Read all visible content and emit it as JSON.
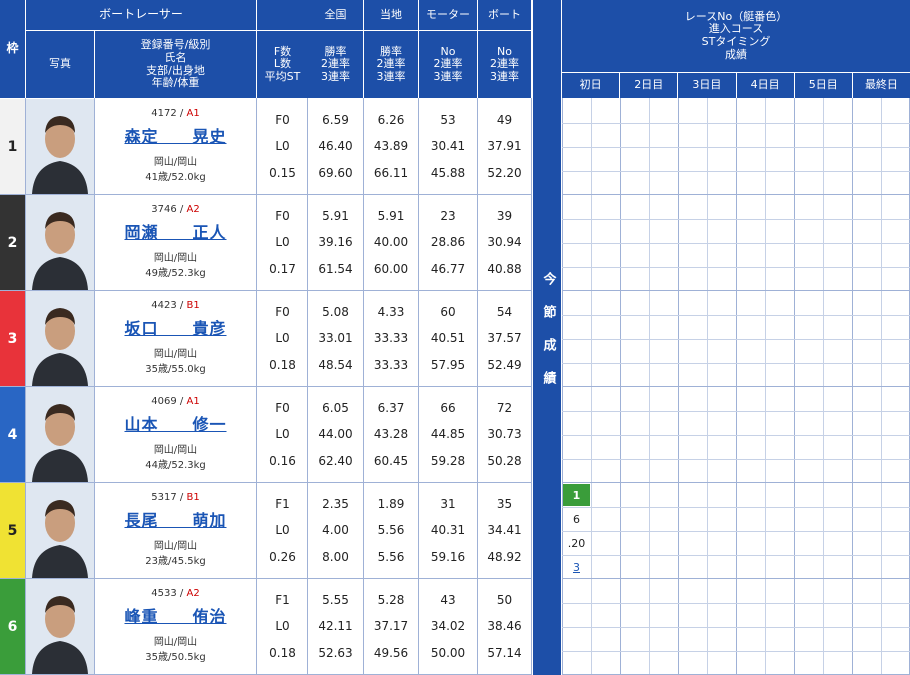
{
  "header": {
    "frame": "枠",
    "boat_racer": "ボートレーサー",
    "national": "全国",
    "local": "当地",
    "motor": "モーター",
    "boat": "ボート",
    "race_info": [
      "レースNo（艇番色）",
      "進入コース",
      "STタイミング",
      "成績"
    ],
    "photo": "写真",
    "racer_info": [
      "登録番号/級別",
      "氏名",
      "支部/出身地",
      "年齢/体重"
    ],
    "fl_st": [
      "F数",
      "L数",
      "平均ST"
    ],
    "rate_nat": [
      "勝率",
      "2連率",
      "3連率"
    ],
    "rate_loc": [
      "勝率",
      "2連率",
      "3連率"
    ],
    "rate_motor": [
      "No",
      "2連率",
      "3連率"
    ],
    "rate_boat": [
      "No",
      "2連率",
      "3連率"
    ],
    "days": [
      "初日",
      "2日目",
      "3日目",
      "4日目",
      "5日目",
      "最終日"
    ],
    "current_results": "今節成績"
  },
  "racers": [
    {
      "frame": "1",
      "reg": "4172",
      "cls": "A1",
      "name": "森定　　晃史",
      "branch": "岡山/岡山",
      "age_weight": "41歳/52.0kg",
      "f": "F0",
      "l": "L0",
      "st": "0.15",
      "nat": [
        "6.59",
        "46.40",
        "69.60"
      ],
      "loc": [
        "6.26",
        "43.89",
        "66.11"
      ],
      "motor": [
        "53",
        "30.41",
        "45.88"
      ],
      "boat": [
        "49",
        "37.91",
        "52.20"
      ]
    },
    {
      "frame": "2",
      "reg": "3746",
      "cls": "A2",
      "name": "岡瀬　　正人",
      "branch": "岡山/岡山",
      "age_weight": "49歳/52.3kg",
      "f": "F0",
      "l": "L0",
      "st": "0.17",
      "nat": [
        "5.91",
        "39.16",
        "61.54"
      ],
      "loc": [
        "5.91",
        "40.00",
        "60.00"
      ],
      "motor": [
        "23",
        "28.86",
        "46.77"
      ],
      "boat": [
        "39",
        "30.94",
        "40.88"
      ]
    },
    {
      "frame": "3",
      "reg": "4423",
      "cls": "B1",
      "name": "坂口　　貴彦",
      "branch": "岡山/岡山",
      "age_weight": "35歳/55.0kg",
      "f": "F0",
      "l": "L0",
      "st": "0.18",
      "nat": [
        "5.08",
        "33.01",
        "48.54"
      ],
      "loc": [
        "4.33",
        "33.33",
        "33.33"
      ],
      "motor": [
        "60",
        "40.51",
        "57.95"
      ],
      "boat": [
        "54",
        "37.57",
        "52.49"
      ]
    },
    {
      "frame": "4",
      "reg": "4069",
      "cls": "A1",
      "name": "山本　　修一",
      "branch": "岡山/岡山",
      "age_weight": "44歳/52.3kg",
      "f": "F0",
      "l": "L0",
      "st": "0.16",
      "nat": [
        "6.05",
        "44.00",
        "62.40"
      ],
      "loc": [
        "6.37",
        "43.28",
        "60.45"
      ],
      "motor": [
        "66",
        "44.85",
        "59.28"
      ],
      "boat": [
        "72",
        "30.73",
        "50.28"
      ]
    },
    {
      "frame": "5",
      "reg": "5317",
      "cls": "B1",
      "name": "長尾　　萌加",
      "branch": "岡山/岡山",
      "age_weight": "23歳/45.5kg",
      "f": "F1",
      "l": "L0",
      "st": "0.26",
      "nat": [
        "2.35",
        "4.00",
        "8.00"
      ],
      "loc": [
        "1.89",
        "5.56",
        "5.56"
      ],
      "motor": [
        "31",
        "40.31",
        "59.16"
      ],
      "boat": [
        "35",
        "34.41",
        "48.92"
      ]
    },
    {
      "frame": "6",
      "reg": "4533",
      "cls": "A2",
      "name": "峰重　　侑治",
      "branch": "岡山/岡山",
      "age_weight": "35歳/50.5kg",
      "f": "F1",
      "l": "L0",
      "st": "0.18",
      "nat": [
        "5.55",
        "42.11",
        "52.63"
      ],
      "loc": [
        "5.28",
        "37.17",
        "49.56"
      ],
      "motor": [
        "43",
        "34.02",
        "50.00"
      ],
      "boat": [
        "50",
        "38.46",
        "57.14"
      ]
    }
  ],
  "frame_colors": [
    "#f2f2f2",
    "#333333",
    "#e8333a",
    "#2966c4",
    "#f0e233",
    "#3a9d3a"
  ],
  "frame_text_colors": [
    "#222222",
    "#ffffff",
    "#ffffff",
    "#ffffff",
    "#222222",
    "#ffffff"
  ],
  "row_bg": [
    "#ffffff",
    "#ffffff",
    "#ffffff",
    "#ffffff",
    "#ffffff",
    "#ffffff"
  ],
  "race_entry": {
    "race_no": "1",
    "course": "6",
    "st": ".20",
    "result": "3"
  },
  "colors": {
    "header_blue": "#1d4fa8",
    "accent_green": "#3a9d3a",
    "link_blue": "#1a55b5"
  }
}
